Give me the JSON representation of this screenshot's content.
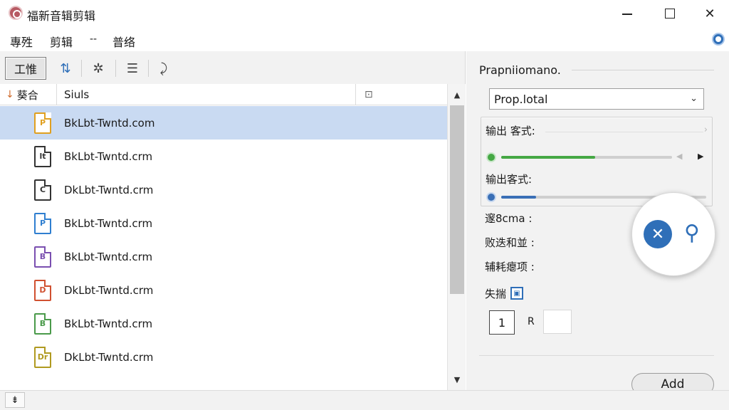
{
  "window": {
    "title": "福新音辑剪辑",
    "min_label": "",
    "close_glyph": "✕"
  },
  "menu": {
    "items": [
      "專殅",
      "剪辑",
      "--",
      "普络"
    ]
  },
  "toolbar": {
    "main_label": "工惟",
    "icons": [
      "sort-icon",
      "gear-cross-icon",
      "document-list-icon",
      "sparkle-arrow-icon"
    ]
  },
  "list": {
    "headers": [
      "葵合",
      "Siuls",
      ""
    ],
    "rows": [
      {
        "name": "BkLbt-Twntd.com",
        "icon_letter": "P",
        "icon_color": "#e0a020",
        "selected": true
      },
      {
        "name": "BkLbt-Twntd.crm",
        "icon_letter": "lt",
        "icon_color": "#333333",
        "selected": false
      },
      {
        "name": "DkLbt-Twntd.crm",
        "icon_letter": "C",
        "icon_color": "#333333",
        "selected": false
      },
      {
        "name": "BkLbt-Twntd.crm",
        "icon_letter": "P",
        "icon_color": "#2f7fd0",
        "selected": false
      },
      {
        "name": "BkLbt-Twntd.crm",
        "icon_letter": "B",
        "icon_color": "#7a4fb0",
        "selected": false
      },
      {
        "name": "DkLbt-Twntd.crm",
        "icon_letter": "D",
        "icon_color": "#d05030",
        "selected": false
      },
      {
        "name": "BkLbt-Twntd.crm",
        "icon_letter": "B",
        "icon_color": "#4a9a4a",
        "selected": false
      },
      {
        "name": "DkLbt-Twntd.crm",
        "icon_letter": "Dr",
        "icon_color": "#b09a20",
        "selected": false
      }
    ]
  },
  "status": {
    "button_glyph": "⇟"
  },
  "properties": {
    "title": "Prapniiomano.",
    "select_value": "Prop.lotal",
    "slider1_label": "输出 客式:",
    "slider1_value": 0.55,
    "slider2_label": "输出客式:",
    "slider2_value": 0.17,
    "field1": "邃8cma :",
    "field2": "败迭和並 :",
    "field3": "辅耗瘪项 :",
    "attach_label": "失揣",
    "number_value": "1",
    "r_label": "R",
    "add_label": "Add",
    "accent_green": "#45a844",
    "accent_blue": "#3a6fb6"
  }
}
